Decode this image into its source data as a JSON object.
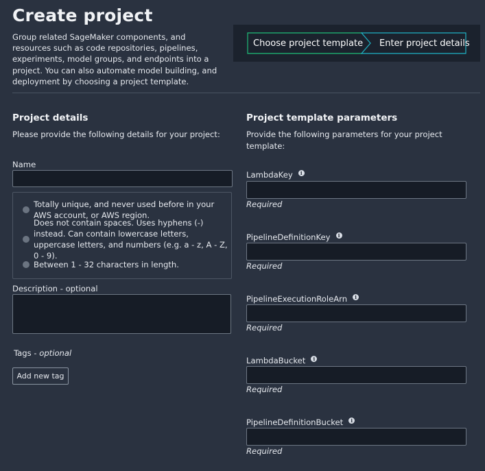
{
  "page": {
    "title": "Create project",
    "intro": "Group related SageMaker components, and resources such as code repositories, pipelines, experiments, model groups, and endpoints into a project. You can also automate model building, and deployment by choosing a project template."
  },
  "steps": [
    {
      "label": "Choose project template",
      "border_color": "#1fbf7a"
    },
    {
      "label": "Enter project details",
      "border_color": "#1fb3c6"
    }
  ],
  "project_details": {
    "title": "Project details",
    "description": "Please provide the following details for your project:",
    "name_label": "Name",
    "name_value": "",
    "rules": [
      "Totally unique, and never used before in your AWS account, or AWS region.",
      "Does not contain spaces. Uses hyphens (-) instead. Can contain lowercase letters, uppercase letters, and numbers (e.g. a - z, A - Z, 0 - 9).",
      "Between 1 - 32 characters in length."
    ],
    "description_label": "Description - optional",
    "description_value": "",
    "tags_label": "Tags - ",
    "tags_optional": "optional",
    "add_tag_button": "Add new tag"
  },
  "template_params": {
    "title": "Project template parameters",
    "description": "Provide the following parameters for your project template:",
    "params": [
      {
        "label": "LambdaKey",
        "value": "",
        "hint": "Required"
      },
      {
        "label": "PipelineDefinitionKey",
        "value": "",
        "hint": "Required"
      },
      {
        "label": "PipelineExecutionRoleArn",
        "value": "",
        "hint": "Required"
      },
      {
        "label": "LambdaBucket",
        "value": "",
        "hint": "Required"
      },
      {
        "label": "PipelineDefinitionBucket",
        "value": "",
        "hint": "Required"
      }
    ]
  },
  "icons": {
    "info": "info-icon",
    "bullet": "bullet-dot-icon"
  }
}
